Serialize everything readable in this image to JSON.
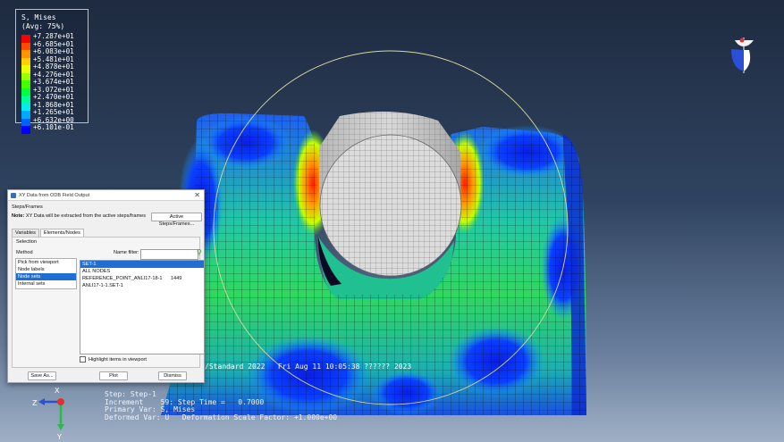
{
  "legend": {
    "title_lines": [
      "S, Mises",
      "(Avg: 75%)"
    ],
    "values": [
      "+7.287e+01",
      "+6.685e+01",
      "+6.083e+01",
      "+5.481e+01",
      "+4.878e+01",
      "+4.276e+01",
      "+3.674e+01",
      "+3.072e+01",
      "+2.470e+01",
      "+1.868e+01",
      "+1.265e+01",
      "+6.632e+00",
      "+6.101e-01"
    ],
    "colors": [
      "#ff0000",
      "#ff4a00",
      "#ff9400",
      "#ffd000",
      "#e8ff00",
      "#9cff00",
      "#44ff00",
      "#00ff40",
      "#00ff9c",
      "#00f0e8",
      "#00a8ff",
      "#0060ff",
      "#0000ff"
    ]
  },
  "viewport_text": {
    "stamp": "/Standard 2022   Fri Aug 11 10:05:38 ?????? 2023",
    "info_lines": [
      "Step: Step-1",
      "Increment    59: Step Time =   0.7000",
      "Primary Var: S, Mises",
      "Deformed Var: U   Deformation Scale Factor: +1.000e+00"
    ],
    "triad_labels": {
      "z": "Z",
      "x": "X",
      "y": "Y"
    }
  },
  "dialog": {
    "title": "XY Data from ODB Field Output",
    "close_glyph": "✕",
    "steps_frames_label": "Steps/Frames",
    "note_label": "Note:",
    "note_text": "XY Data will be extracted from the active steps/frames",
    "active_steps_button": "Active Steps/Frames...",
    "tabs": [
      "Variables",
      "Elements/Nodes"
    ],
    "selection_label": "Selection",
    "method_label": "Method",
    "name_filter_label": "Name filter:",
    "name_filter_value": "",
    "methods": [
      "Pick from viewport",
      "Node labels",
      "Node sets",
      "Internal sets"
    ],
    "selected_method_index": 2,
    "sets": [
      "SET-1",
      "ALL NODES",
      "REFERENCE_POINT_ANLI17-18-1      1449",
      "ANLI17-1-1.SET-1"
    ],
    "selected_set_index": 0,
    "highlight_label": "Highlight items in viewport",
    "save_button": "Save As...",
    "plot_button": "Plot",
    "dismiss_button": "Dismiss"
  },
  "colors": {
    "background_top": "#1e2b40",
    "background_bottom": "#9fb0c6",
    "selection_blue": "#1f6fd2"
  }
}
